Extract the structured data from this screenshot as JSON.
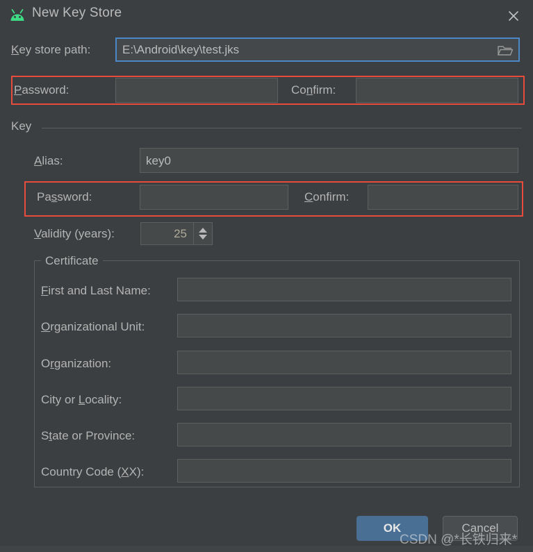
{
  "window": {
    "title": "New Key Store",
    "icon": "android-robot-icon",
    "close_icon": "close-icon",
    "background_color": "#3c3f41",
    "accent_color": "#4a6f94",
    "highlight_color": "#e74c3c"
  },
  "keystore": {
    "path_label": "Key store path:",
    "path_label_mnemonic": "K",
    "path_value": "E:\\Android\\key\\test.jks",
    "browse_icon": "folder-icon",
    "password_label": "Password:",
    "password_label_mnemonic": "P",
    "password_value": "",
    "confirm_label": "Confirm:",
    "confirm_label_mnemonic": "n",
    "confirm_value": ""
  },
  "key_section": {
    "title": "Key",
    "alias_label": "Alias:",
    "alias_label_mnemonic": "A",
    "alias_value": "key0",
    "password_label": "Password:",
    "password_label_mnemonic": "s",
    "password_value": "",
    "confirm_label": "Confirm:",
    "confirm_label_mnemonic": "C",
    "confirm_value": "",
    "validity_label": "Validity (years):",
    "validity_label_mnemonic": "V",
    "validity_value": "25"
  },
  "certificate": {
    "legend": "Certificate",
    "fields": [
      {
        "label": "First and Last Name:",
        "mnemonic": "F",
        "value": "",
        "name": "first-and-last-name"
      },
      {
        "label": "Organizational Unit:",
        "mnemonic": "O",
        "value": "",
        "name": "organizational-unit"
      },
      {
        "label": "Organization:",
        "mnemonic": "r",
        "value": "",
        "name": "organization"
      },
      {
        "label": "City or Locality:",
        "mnemonic": "L",
        "value": "",
        "name": "city-or-locality"
      },
      {
        "label": "State or Province:",
        "mnemonic": "t",
        "value": "",
        "name": "state-or-province"
      },
      {
        "label": "Country Code (XX):",
        "mnemonic": "X",
        "value": "",
        "name": "country-code"
      }
    ]
  },
  "buttons": {
    "ok": "OK",
    "cancel": "Cancel"
  },
  "watermark": {
    "text": "CSDN @*长铁归来*"
  }
}
